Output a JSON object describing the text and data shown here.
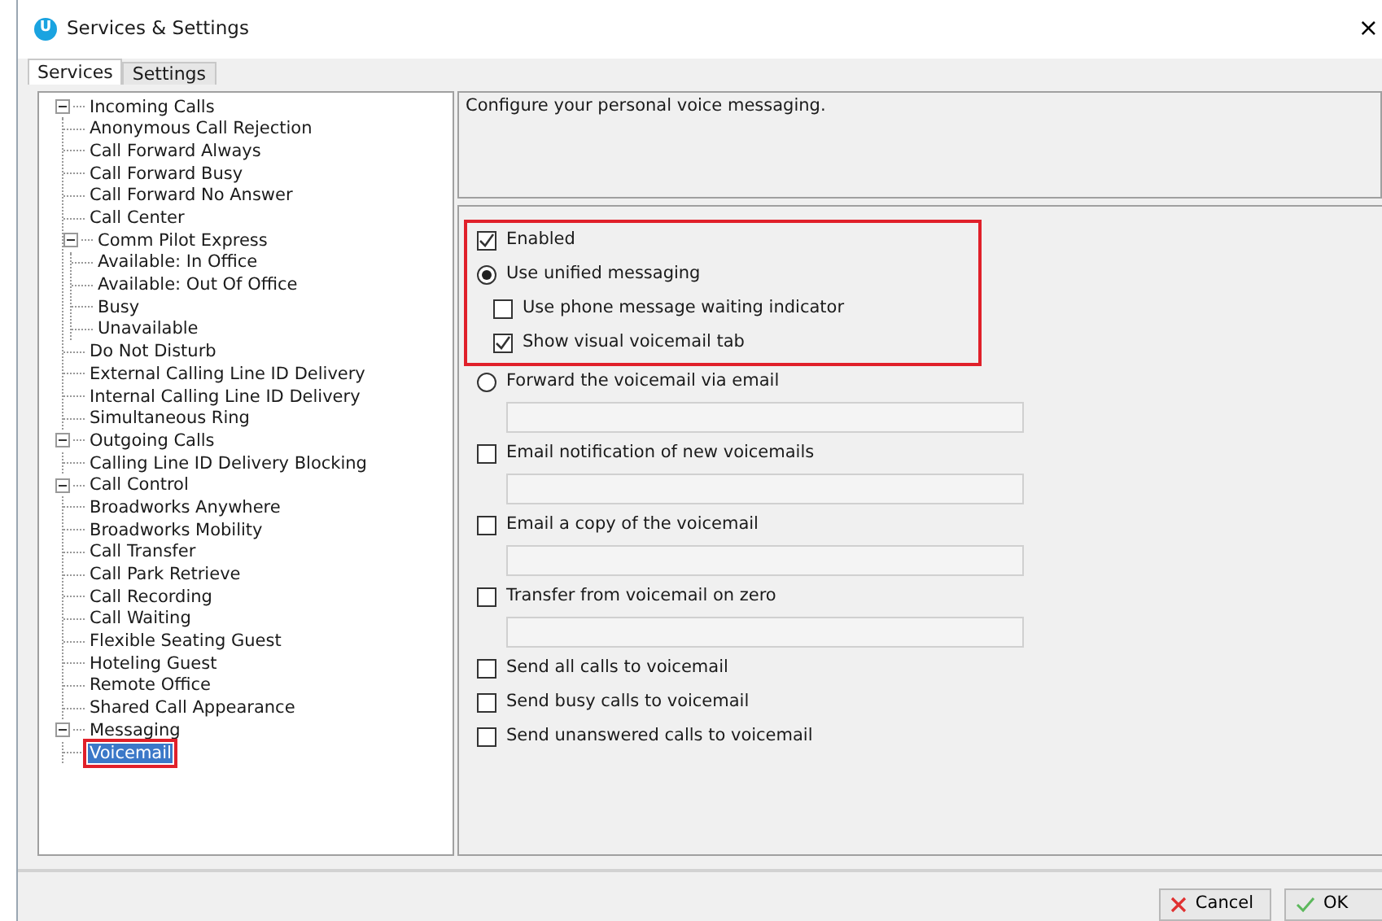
{
  "window": {
    "title": "Services & Settings",
    "icon_letter": "U",
    "close": "×"
  },
  "tabs": [
    {
      "label": "Services",
      "selected": true
    },
    {
      "label": "Settings",
      "selected": false
    }
  ],
  "tree": [
    {
      "label": "Incoming Calls",
      "expanded": true,
      "selected": false,
      "highlighted": false,
      "children": [
        {
          "label": "Anonymous Call Rejection",
          "selected": false,
          "highlighted": false
        },
        {
          "label": "Call Forward Always",
          "selected": false,
          "highlighted": false
        },
        {
          "label": "Call Forward Busy",
          "selected": false,
          "highlighted": false
        },
        {
          "label": "Call Forward No Answer",
          "selected": false,
          "highlighted": false
        },
        {
          "label": "Call Center",
          "selected": false,
          "highlighted": false
        },
        {
          "label": "Comm Pilot Express",
          "expanded": true,
          "selected": false,
          "highlighted": false,
          "children": [
            {
              "label": "Available: In Office",
              "selected": false,
              "highlighted": false
            },
            {
              "label": "Available: Out Of Office",
              "selected": false,
              "highlighted": false
            },
            {
              "label": "Busy",
              "selected": false,
              "highlighted": false
            },
            {
              "label": "Unavailable",
              "selected": false,
              "highlighted": false
            }
          ]
        },
        {
          "label": "Do Not Disturb",
          "selected": false,
          "highlighted": false
        },
        {
          "label": "External Calling Line ID Delivery",
          "selected": false,
          "highlighted": false
        },
        {
          "label": "Internal Calling Line ID Delivery",
          "selected": false,
          "highlighted": false
        },
        {
          "label": "Simultaneous Ring",
          "selected": false,
          "highlighted": false
        }
      ]
    },
    {
      "label": "Outgoing Calls",
      "expanded": true,
      "selected": false,
      "highlighted": false,
      "children": [
        {
          "label": "Calling Line ID Delivery Blocking",
          "selected": false,
          "highlighted": false
        }
      ]
    },
    {
      "label": "Call Control",
      "expanded": true,
      "selected": false,
      "highlighted": false,
      "children": [
        {
          "label": "Broadworks Anywhere",
          "selected": false,
          "highlighted": false
        },
        {
          "label": "Broadworks Mobility",
          "selected": false,
          "highlighted": false
        },
        {
          "label": "Call Transfer",
          "selected": false,
          "highlighted": false
        },
        {
          "label": "Call Park Retrieve",
          "selected": false,
          "highlighted": false
        },
        {
          "label": "Call Recording",
          "selected": false,
          "highlighted": false
        },
        {
          "label": "Call Waiting",
          "selected": false,
          "highlighted": false
        },
        {
          "label": "Flexible Seating Guest",
          "selected": false,
          "highlighted": false
        },
        {
          "label": "Hoteling Guest",
          "selected": false,
          "highlighted": false
        },
        {
          "label": "Remote Office",
          "selected": false,
          "highlighted": false
        },
        {
          "label": "Shared Call Appearance",
          "selected": false,
          "highlighted": false
        }
      ]
    },
    {
      "label": "Messaging",
      "expanded": true,
      "selected": false,
      "highlighted": false,
      "children": [
        {
          "label": "Voicemail",
          "selected": true,
          "highlighted": true
        }
      ]
    }
  ],
  "description": "Configure your personal voice messaging.",
  "options": [
    {
      "kind": "checkbox",
      "label": "Enabled",
      "checked": true,
      "highlighted": true
    },
    {
      "kind": "radio",
      "label": "Use unified messaging",
      "checked": true,
      "highlighted": true,
      "children": [
        {
          "kind": "checkbox",
          "label": "Use phone message waiting indicator",
          "checked": false,
          "highlighted": true
        },
        {
          "kind": "checkbox",
          "label": "Show visual voicemail tab",
          "checked": true,
          "highlighted": true
        }
      ]
    },
    {
      "kind": "radio",
      "label": "Forward the voicemail via email",
      "checked": false,
      "highlighted": false,
      "has_field": true
    },
    {
      "kind": "checkbox",
      "label": "Email notification of new voicemails",
      "checked": false,
      "highlighted": false,
      "has_field": true
    },
    {
      "kind": "checkbox",
      "label": "Email a copy of the voicemail",
      "checked": false,
      "highlighted": false,
      "has_field": true
    },
    {
      "kind": "checkbox",
      "label": "Transfer from voicemail on zero",
      "checked": false,
      "highlighted": false,
      "has_field": true
    },
    {
      "kind": "checkbox",
      "label": "Send all calls to voicemail",
      "checked": false,
      "highlighted": false
    },
    {
      "kind": "checkbox",
      "label": "Send busy calls to voicemail",
      "checked": false,
      "highlighted": false
    },
    {
      "kind": "checkbox",
      "label": "Send unanswered calls to voicemail",
      "checked": false,
      "highlighted": false
    }
  ],
  "buttons": [
    {
      "kind": "cancel",
      "label": "Cancel"
    },
    {
      "kind": "ok",
      "label": "OK"
    }
  ]
}
